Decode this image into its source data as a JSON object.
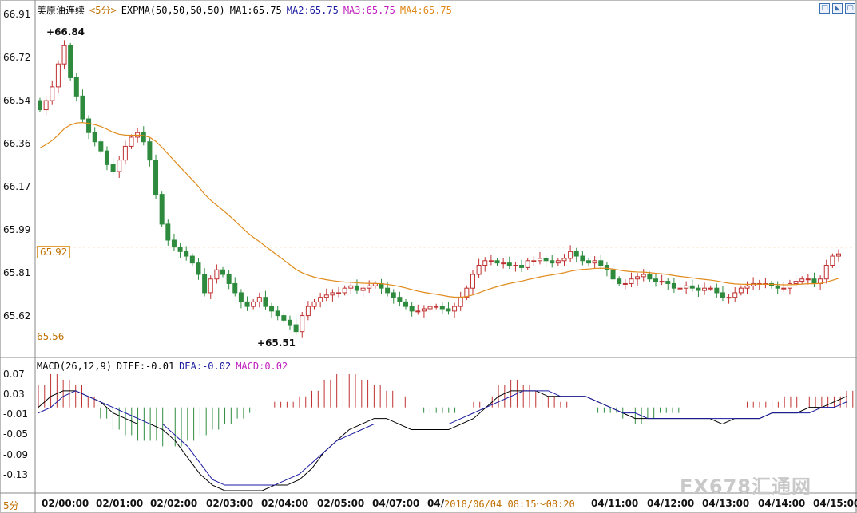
{
  "header": {
    "instrument": "美原油连续",
    "period": "<5分>",
    "indicator": "EXPMA(50,50,50,50)",
    "ma1": "MA1:65.75",
    "ma2": "MA2:65.75",
    "ma3": "MA3:65.75",
    "ma4": "MA4:65.75"
  },
  "macd_header": {
    "title": "MACD(26,12,9)",
    "diff": "DIFF:-0.01",
    "dea": "DEA:-0.02",
    "macd": "MACD:0.02"
  },
  "colors": {
    "up": "#c03030",
    "down": "#2e8b3e",
    "ma": "#e08a1a",
    "ma3": "#c020c0",
    "macd_pos": "#c03030",
    "macd_neg": "#2e8b3e",
    "diff": "#000000",
    "dea": "#1a1aa0"
  },
  "price_axis": [
    "66.91",
    "66.72",
    "66.54",
    "66.36",
    "66.17",
    "65.99",
    "65.81",
    "65.62"
  ],
  "price_current_label": "65.92",
  "price_low_axis_label": "65.56",
  "high_marker": "66.84",
  "low_marker": "65.51",
  "macd_axis": [
    "0.07",
    "0.03",
    "-0.01",
    "-0.05",
    "-0.09",
    "-0.13"
  ],
  "left_axis_unit": "5分",
  "time_labels": [
    "02/00:00",
    "02/01:00",
    "02/02:00",
    "02/03:00",
    "02/04:00",
    "02/05:00",
    "04/07:00",
    "04/0",
    "04/11:00",
    "04/12:00",
    "04/13:00",
    "04/14:00",
    "04/15:00"
  ],
  "time_box": "2018/06/04 08:15～08:20",
  "watermark": "FX678汇通网",
  "controls": [
    "□",
    "◣",
    "▢"
  ],
  "chart_data": {
    "type": "candlestick",
    "ylim": [
      65.5,
      66.93
    ],
    "macd_ylim": [
      -0.15,
      0.07
    ],
    "closes": [
      66.52,
      66.56,
      66.62,
      66.72,
      66.8,
      66.66,
      66.58,
      66.48,
      66.42,
      66.38,
      66.34,
      66.28,
      66.25,
      66.3,
      66.36,
      66.4,
      66.42,
      66.38,
      66.3,
      66.15,
      66.02,
      65.95,
      65.92,
      65.9,
      65.88,
      65.85,
      65.8,
      65.72,
      65.78,
      65.82,
      65.8,
      65.76,
      65.72,
      65.68,
      65.66,
      65.68,
      65.7,
      65.66,
      65.64,
      65.62,
      65.6,
      65.58,
      65.55,
      65.62,
      65.66,
      65.68,
      65.7,
      65.71,
      65.72,
      65.72,
      65.74,
      65.75,
      65.73,
      65.74,
      65.75,
      65.76,
      65.74,
      65.72,
      65.7,
      65.68,
      65.66,
      65.64,
      65.64,
      65.65,
      65.66,
      65.66,
      65.65,
      65.64,
      65.66,
      65.7,
      65.74,
      65.8,
      65.84,
      65.86,
      65.86,
      65.85,
      65.85,
      65.84,
      65.84,
      65.83,
      65.86,
      65.86,
      65.87,
      65.86,
      65.85,
      65.86,
      65.87,
      65.9,
      65.88,
      65.86,
      65.85,
      65.86,
      65.84,
      65.82,
      65.78,
      65.76,
      65.76,
      65.78,
      65.79,
      65.8,
      65.78,
      65.77,
      65.77,
      65.76,
      65.74,
      65.74,
      65.75,
      65.74,
      65.73,
      65.74,
      65.74,
      65.72,
      65.7,
      65.7,
      65.72,
      65.74,
      65.75,
      65.76,
      65.76,
      65.76,
      65.75,
      65.74,
      65.74,
      65.76,
      65.77,
      65.78,
      65.78,
      65.76,
      65.78,
      65.84,
      65.88,
      65.89
    ],
    "macd": {
      "diff": [
        0.0,
        0.02,
        0.03,
        0.03,
        0.02,
        0.01,
        -0.01,
        -0.02,
        -0.03,
        -0.03,
        -0.04,
        -0.06,
        -0.09,
        -0.12,
        -0.14,
        -0.15,
        -0.15,
        -0.15,
        -0.15,
        -0.14,
        -0.14,
        -0.13,
        -0.11,
        -0.08,
        -0.06,
        -0.04,
        -0.03,
        -0.02,
        -0.02,
        -0.03,
        -0.04,
        -0.04,
        -0.04,
        -0.04,
        -0.03,
        -0.02,
        0.0,
        0.02,
        0.03,
        0.03,
        0.03,
        0.02,
        0.02,
        0.02,
        0.02,
        0.01,
        0.0,
        -0.01,
        -0.02,
        -0.02,
        -0.02,
        -0.02,
        -0.02,
        -0.02,
        -0.02,
        -0.03,
        -0.02,
        -0.02,
        -0.02,
        -0.01,
        -0.01,
        -0.01,
        0.0,
        0.0,
        0.01,
        0.02
      ],
      "dea": [
        -0.01,
        0.0,
        0.02,
        0.03,
        0.02,
        0.01,
        0.0,
        -0.01,
        -0.02,
        -0.03,
        -0.03,
        -0.05,
        -0.07,
        -0.1,
        -0.13,
        -0.14,
        -0.14,
        -0.14,
        -0.14,
        -0.14,
        -0.13,
        -0.12,
        -0.1,
        -0.08,
        -0.06,
        -0.05,
        -0.04,
        -0.03,
        -0.03,
        -0.03,
        -0.03,
        -0.03,
        -0.03,
        -0.03,
        -0.02,
        -0.01,
        0.0,
        0.01,
        0.02,
        0.03,
        0.03,
        0.03,
        0.02,
        0.02,
        0.02,
        0.01,
        0.0,
        -0.01,
        -0.01,
        -0.02,
        -0.02,
        -0.02,
        -0.02,
        -0.02,
        -0.02,
        -0.02,
        -0.02,
        -0.02,
        -0.02,
        -0.01,
        -0.01,
        -0.01,
        -0.01,
        0.0,
        0.0,
        0.01
      ],
      "hist": [
        0.04,
        0.06,
        0.05,
        0.04,
        0.02,
        -0.02,
        -0.04,
        -0.05,
        -0.06,
        -0.06,
        -0.07,
        -0.07,
        -0.06,
        -0.05,
        -0.04,
        -0.03,
        -0.02,
        -0.01,
        0.0,
        0.01,
        0.01,
        0.02,
        0.03,
        0.05,
        0.06,
        0.06,
        0.05,
        0.04,
        0.03,
        0.02,
        0.0,
        -0.01,
        -0.01,
        -0.01,
        0.0,
        0.01,
        0.02,
        0.04,
        0.05,
        0.04,
        0.03,
        0.02,
        0.01,
        0.0,
        0.0,
        -0.01,
        -0.01,
        -0.02,
        -0.03,
        -0.02,
        -0.01,
        -0.01,
        0.0,
        0.0,
        0.0,
        0.0,
        0.0,
        0.01,
        0.01,
        0.01,
        0.02,
        0.02,
        0.02,
        0.02,
        0.02,
        0.03
      ]
    }
  }
}
